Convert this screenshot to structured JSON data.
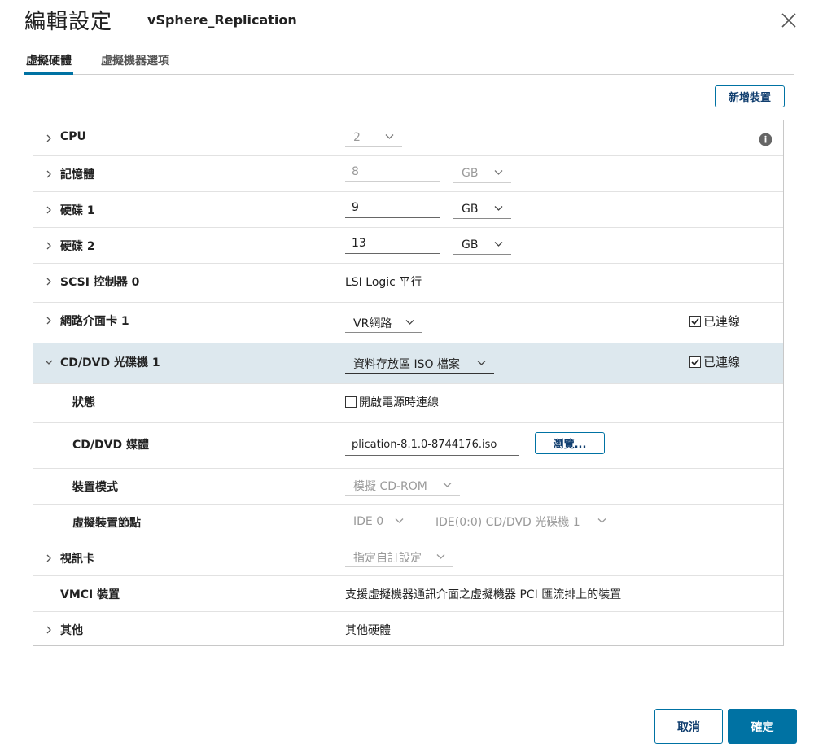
{
  "dialog": {
    "title": "編輯設定",
    "vm_name": "vSphere_Replication"
  },
  "tabs": [
    {
      "label": "虛擬硬體",
      "active": true
    },
    {
      "label": "虛擬機器選項",
      "active": false
    }
  ],
  "toolbar": {
    "add_device_label": "新增裝置"
  },
  "rows": {
    "cpu": {
      "label": "CPU",
      "value": "2"
    },
    "memory": {
      "label": "記憶體",
      "value": "8",
      "unit": "GB"
    },
    "disk1": {
      "label": "硬碟 1",
      "value": "9",
      "unit": "GB"
    },
    "disk2": {
      "label": "硬碟 2",
      "value": "13",
      "unit": "GB"
    },
    "scsi": {
      "label": "SCSI 控制器 0",
      "value": "LSI Logic 平行"
    },
    "nic": {
      "label": "網路介面卡 1",
      "value": "VR網路",
      "connected_label": "已連線",
      "connected": true
    },
    "cddvd": {
      "label": "CD/DVD 光碟機 1",
      "value": "資料存放區 ISO 檔案",
      "connected_label": "已連線",
      "connected": true,
      "status": {
        "label": "狀態",
        "power_on_label": "開啟電源時連線",
        "power_on_checked": false
      },
      "media": {
        "label": "CD/DVD 媒體",
        "value": "plication-8.1.0-8744176.iso",
        "browse_label": "瀏覽..."
      },
      "mode": {
        "label": "裝置模式",
        "value": "模擬 CD-ROM"
      },
      "node": {
        "label": "虛擬裝置節點",
        "bus": "IDE 0",
        "slot": "IDE(0:0) CD/DVD 光碟機 1"
      }
    },
    "video": {
      "label": "視訊卡",
      "value": "指定自訂設定"
    },
    "vmci": {
      "label": "VMCI 裝置",
      "value": "支援虛擬機器通訊介面之虛擬機器 PCI 匯流排上的裝置"
    },
    "other": {
      "label": "其他",
      "value": "其他硬體"
    }
  },
  "footer": {
    "cancel_label": "取消",
    "ok_label": "確定"
  },
  "colors": {
    "accent": "#0072a3",
    "expanded_row": "#dde8ee"
  }
}
